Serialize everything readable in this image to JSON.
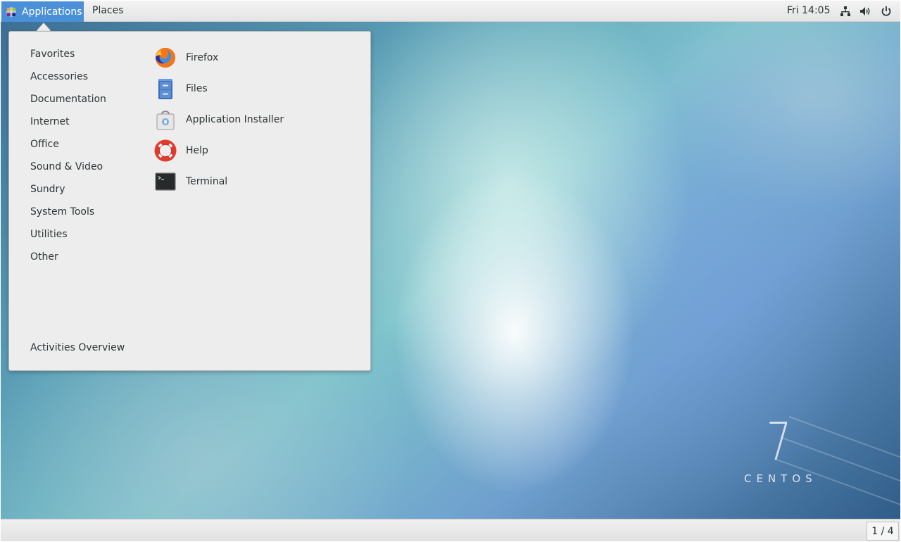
{
  "top_bar": {
    "applications_label": "Applications",
    "places_label": "Places",
    "clock": "Fri 14:05",
    "tray_icons": [
      "network-icon",
      "volume-icon",
      "power-icon"
    ]
  },
  "apps_menu": {
    "categories": [
      {
        "label": "Favorites"
      },
      {
        "label": "Accessories"
      },
      {
        "label": "Documentation"
      },
      {
        "label": "Internet"
      },
      {
        "label": "Office"
      },
      {
        "label": "Sound & Video"
      },
      {
        "label": "Sundry"
      },
      {
        "label": "System Tools"
      },
      {
        "label": "Utilities"
      },
      {
        "label": "Other"
      }
    ],
    "apps": [
      {
        "label": "Firefox",
        "icon": "firefox-icon"
      },
      {
        "label": "Files",
        "icon": "files-icon"
      },
      {
        "label": "Application Installer",
        "icon": "software-installer-icon"
      },
      {
        "label": "Help",
        "icon": "help-lifebuoy-icon"
      },
      {
        "label": "Terminal",
        "icon": "terminal-icon"
      }
    ],
    "activities_overview": "Activities Overview"
  },
  "desktop": {
    "logo_number": "7",
    "logo_text": "CENTOS"
  },
  "bottom_bar": {
    "workspace": "1 / 4"
  },
  "colors": {
    "accent": "#4a90d9",
    "menu_bg": "#ededed",
    "text": "#2e3436"
  }
}
